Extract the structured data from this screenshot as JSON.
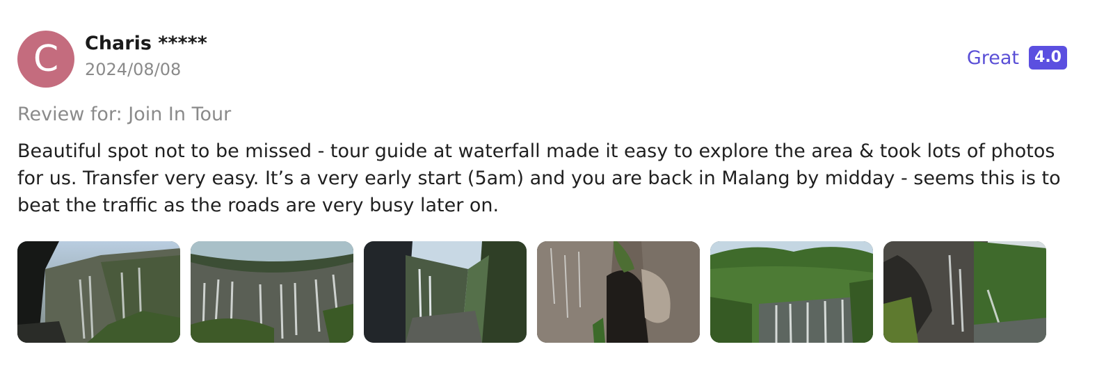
{
  "reviewer": {
    "avatar_initial": "C",
    "name": "Charis *****",
    "date": "2024/08/08"
  },
  "rating": {
    "label": "Great",
    "score": "4.0",
    "accent_color": "#5b4fe0"
  },
  "review": {
    "review_for": "Review for: Join In Tour",
    "body": "Beautiful spot not to be missed - tour guide at waterfall made it easy to explore the area & took lots of photos for us. Transfer very easy. It’s a very early start (5am) and you are back in Malang by midday - seems this is to beat the traffic as the roads are very busy later on."
  },
  "photos": [
    {
      "icon": "waterfall-photo"
    },
    {
      "icon": "waterfall-photo"
    },
    {
      "icon": "waterfall-photo"
    },
    {
      "icon": "rock-cave-photo"
    },
    {
      "icon": "waterfall-photo"
    },
    {
      "icon": "waterfall-photo"
    }
  ]
}
